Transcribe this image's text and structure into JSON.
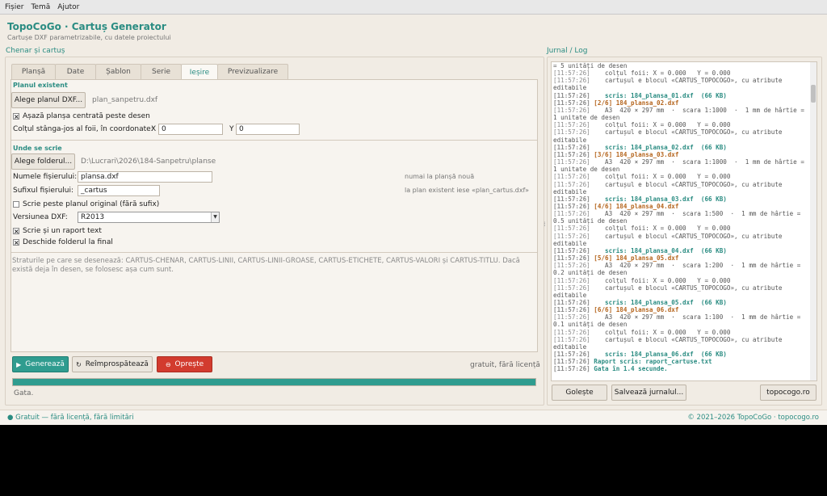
{
  "menu": [
    "Fișier",
    "Temă",
    "Ajutor"
  ],
  "app": {
    "title": "TopoCoGo · Cartuș Generator",
    "subtitle": "Cartușe DXF parametrizabile, cu datele proiectului"
  },
  "left": {
    "section_title": "Chenar și cartuș",
    "tabs": [
      "Planșă",
      "Date",
      "Șablon",
      "Serie",
      "Ieșire",
      "Previzualizare"
    ],
    "active_tab": "Ieșire",
    "existing_plan": {
      "title": "Planul existent",
      "choose_button": "Alege planul DXF...",
      "file_name": "plan_sanpetru.dxf",
      "center_checkbox": "Așază planșa centrată peste desen",
      "center_checked": true,
      "corner_label": "Colțul stânga-jos al foii, în coordonate:",
      "x_label": "X",
      "x_value": "0",
      "y_label": "Y",
      "y_value": "0"
    },
    "output": {
      "title": "Unde se scrie",
      "folder_button": "Alege folderul...",
      "folder_path": "D:\\Lucrari\\2026\\184-Sanpetru\\planse",
      "filename_label": "Numele fișierului:",
      "filename_value": "plansa.dxf",
      "filename_hint": "numai la planșă nouă",
      "suffix_label": "Sufixul fișierului:",
      "suffix_value": "_cartus",
      "suffix_hint": "la plan existent iese «plan_cartus.dxf»",
      "overwrite_checkbox": "Scrie peste planul original (fără sufix)",
      "overwrite_checked": false,
      "dxf_label": "Versiunea DXF:",
      "dxf_value": "R2013",
      "report_checkbox": "Scrie și un raport text",
      "report_checked": true,
      "open_folder_checkbox": "Deschide folderul la final",
      "open_folder_checked": true
    },
    "info_text": "Straturile pe care se desenează: CARTUS-CHENAR, CARTUS-LINII, CARTUS-LINII-GROASE, CARTUS-ETICHETE, CARTUS-VALORI și CARTUS-TITLU. Dacă există deja în desen, se folosesc așa cum sunt.",
    "actions": {
      "generate": "Generează",
      "refresh": "Reîmprospătează",
      "stop": "Oprește",
      "license": "gratuit, fără licență"
    },
    "progress": 1.0,
    "status": "Gata."
  },
  "log": {
    "title": "Jurnal / Log",
    "lines": [
      {
        "ts": "",
        "text": "= 5 unități de desen",
        "kind": "plain"
      },
      {
        "ts": "[11:57:26]",
        "text": "   colțul foii: X = 0.000   Y = 0.000",
        "kind": "plain"
      },
      {
        "ts": "[11:57:26]",
        "text": "   cartușul e blocul «CARTUS_TOPOCOGO», cu atribute editabile",
        "kind": "plain"
      },
      {
        "ts": "[11:57:26]",
        "text": "   scris: 184_plansa_01.dxf  (66 KB)",
        "kind": "ok"
      },
      {
        "ts": "[11:57:26]",
        "text": "[2/6] 184_plansa_02.dxf",
        "kind": "head"
      },
      {
        "ts": "[11:57:26]",
        "text": "   A3  420 × 297 mm  ·  scara 1:1000  ·  1 mm de hârtie = 1 unitate de desen",
        "kind": "plain"
      },
      {
        "ts": "[11:57:26]",
        "text": "   colțul foii: X = 0.000   Y = 0.000",
        "kind": "plain"
      },
      {
        "ts": "[11:57:26]",
        "text": "   cartușul e blocul «CARTUS_TOPOCOGO», cu atribute editabile",
        "kind": "plain"
      },
      {
        "ts": "[11:57:26]",
        "text": "   scris: 184_plansa_02.dxf  (66 KB)",
        "kind": "ok"
      },
      {
        "ts": "[11:57:26]",
        "text": "[3/6] 184_plansa_03.dxf",
        "kind": "head"
      },
      {
        "ts": "[11:57:26]",
        "text": "   A3  420 × 297 mm  ·  scara 1:1000  ·  1 mm de hârtie = 1 unitate de desen",
        "kind": "plain"
      },
      {
        "ts": "[11:57:26]",
        "text": "   colțul foii: X = 0.000   Y = 0.000",
        "kind": "plain"
      },
      {
        "ts": "[11:57:26]",
        "text": "   cartușul e blocul «CARTUS_TOPOCOGO», cu atribute editabile",
        "kind": "plain"
      },
      {
        "ts": "[11:57:26]",
        "text": "   scris: 184_plansa_03.dxf  (66 KB)",
        "kind": "ok"
      },
      {
        "ts": "[11:57:26]",
        "text": "[4/6] 184_plansa_04.dxf",
        "kind": "head"
      },
      {
        "ts": "[11:57:26]",
        "text": "   A3  420 × 297 mm  ·  scara 1:500  ·  1 mm de hârtie = 0.5 unități de desen",
        "kind": "plain"
      },
      {
        "ts": "[11:57:26]",
        "text": "   colțul foii: X = 0.000   Y = 0.000",
        "kind": "plain"
      },
      {
        "ts": "[11:57:26]",
        "text": "   cartușul e blocul «CARTUS_TOPOCOGO», cu atribute editabile",
        "kind": "plain"
      },
      {
        "ts": "[11:57:26]",
        "text": "   scris: 184_plansa_04.dxf  (66 KB)",
        "kind": "ok"
      },
      {
        "ts": "[11:57:26]",
        "text": "[5/6] 184_plansa_05.dxf",
        "kind": "head"
      },
      {
        "ts": "[11:57:26]",
        "text": "   A3  420 × 297 mm  ·  scara 1:200  ·  1 mm de hârtie = 0.2 unități de desen",
        "kind": "plain"
      },
      {
        "ts": "[11:57:26]",
        "text": "   colțul foii: X = 0.000   Y = 0.000",
        "kind": "plain"
      },
      {
        "ts": "[11:57:26]",
        "text": "   cartușul e blocul «CARTUS_TOPOCOGO», cu atribute editabile",
        "kind": "plain"
      },
      {
        "ts": "[11:57:26]",
        "text": "   scris: 184_plansa_05.dxf  (66 KB)",
        "kind": "ok"
      },
      {
        "ts": "[11:57:26]",
        "text": "[6/6] 184_plansa_06.dxf",
        "kind": "head"
      },
      {
        "ts": "[11:57:26]",
        "text": "   A3  420 × 297 mm  ·  scara 1:100  ·  1 mm de hârtie = 0.1 unități de desen",
        "kind": "plain"
      },
      {
        "ts": "[11:57:26]",
        "text": "   colțul foii: X = 0.000   Y = 0.000",
        "kind": "plain"
      },
      {
        "ts": "[11:57:26]",
        "text": "   cartușul e blocul «CARTUS_TOPOCOGO», cu atribute editabile",
        "kind": "plain"
      },
      {
        "ts": "[11:57:26]",
        "text": "   scris: 184_plansa_06.dxf  (66 KB)",
        "kind": "ok"
      },
      {
        "ts": "[11:57:26]",
        "text": "Raport scris: raport_cartuse.txt",
        "kind": "ok"
      },
      {
        "ts": "[11:57:26]",
        "text": "Gata în 1.4 secunde.",
        "kind": "ok"
      }
    ],
    "buttons": {
      "clear": "Golește",
      "save": "Salvează jurnalul...",
      "site": "topocogo.ro"
    }
  },
  "footer": {
    "left": "● Gratuit — fără licență, fără limitări",
    "right": "© 2021–2026 TopoCoGo · topocogo.ro"
  },
  "colors": {
    "accent": "#2a8c82",
    "generate": "#2f9c8f",
    "stop": "#d23b2e",
    "log_head": "#b5651d"
  }
}
